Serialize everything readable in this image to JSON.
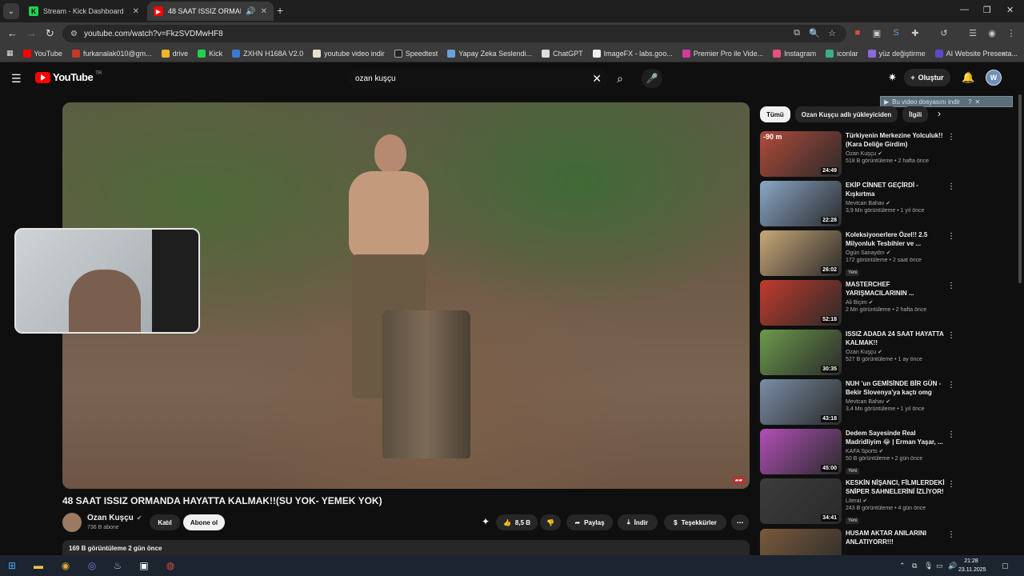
{
  "browser": {
    "tabs": [
      {
        "title": "Stream - Kick Dashboard",
        "favicon": "kick-icon",
        "active": false
      },
      {
        "title": "48 SAAT ISSIZ ORMANDA H",
        "favicon": "youtube-icon",
        "active": true
      }
    ],
    "url": "youtube.com/watch?v=FkzSVDMwHF8",
    "bookmarks": [
      "YouTube",
      "furkanalak010@gm...",
      "drive",
      "Kick",
      "ZXHN H168A V2.0",
      "youtube video indir",
      "Speedtest",
      "Yapay Zeka Seslendi...",
      "ChatGPT",
      "ImageFX - labs.goo...",
      "Premier Pro ile Vide...",
      "Instagram",
      "iconlar",
      "yüz değiştirme",
      "AI Website Presenta..."
    ]
  },
  "youtube": {
    "logo_text": "YouTube",
    "logo_country": "TR",
    "search_query": "ozan kuşçu",
    "create_label": "Oluştur",
    "avatar_letter": "W",
    "download_banner": "Bu video dosyasını indir",
    "download_banner_help": "?",
    "download_banner_close": "✕"
  },
  "video": {
    "title": "48 SAAT ISSIZ ORMANDA HAYATTA KALMAK!!(SU YOK- YEMEK YOK)",
    "channel": "Ozan Kuşçu",
    "subscribers": "736 B abone",
    "join_label": "Katıl",
    "subscribe_label": "Abone ol",
    "likes": "8,5 B",
    "share_label": "Paylaş",
    "download_label": "İndir",
    "thanks_label": "Teşekkürler",
    "views_date": "169 B görüntüleme  2 gün önce"
  },
  "chips": [
    "Tümü",
    "Ozan Kuşçu adlı yükleyiciden",
    "İlgili"
  ],
  "recommendations": [
    {
      "title": "Türkiyenin Merkezine Yolculuk!! (Kara Deliğe Girdim)",
      "channel": "Ozan Kuşçu",
      "meta": "518 B görüntüleme • 2 hafta önce",
      "duration": "24:49",
      "badge": "",
      "color": "#b04a3a"
    },
    {
      "title": "EKİP CİNNET GEÇİRDİ - Kışkırtma",
      "channel": "Mevtcan Bahav",
      "meta": "3,9 Mn görüntüleme • 1 yıl önce",
      "duration": "22:28",
      "badge": "",
      "color": "#8aa7c8"
    },
    {
      "title": "Koleksiyonerlere Özel!! 2.5 Milyonluk Tesbihler ve ...",
      "channel": "Ogün Sanaydın",
      "meta": "172 görüntüleme • 2 saat önce",
      "duration": "26:02",
      "badge": "Yeni",
      "color": "#c9a878"
    },
    {
      "title": "MASTERCHEF YARIŞMACILARININ ...",
      "channel": "Ali Biçim",
      "meta": "2 Mn görüntüleme • 2 hafta önce",
      "duration": "52:18",
      "badge": "",
      "color": "#c23a2c"
    },
    {
      "title": "ISSIZ ADADA 24 SAAT HAYATTA KALMAK!!",
      "channel": "Ozan Kuşçu",
      "meta": "527 B görüntüleme • 1 ay önce",
      "duration": "30:35",
      "badge": "",
      "color": "#6c9a4c"
    },
    {
      "title": "NUH 'un GEMİSİNDE BİR GÜN - Bekir Slovenya'ya kaçtı omg",
      "channel": "Mevtcan Bahav",
      "meta": "3,4 Mn görüntüleme • 1 yıl önce",
      "duration": "43:18",
      "badge": "",
      "color": "#7a8ea6"
    },
    {
      "title": "Dedem Sayesinde Real Madridliyim 😂 | Erman Yaşar, ...",
      "channel": "KAFA Sports",
      "meta": "50 B görüntüleme • 2 gün önce",
      "duration": "45:00",
      "badge": "Yeni",
      "color": "#b24fb8"
    },
    {
      "title": "KESKİN NİŞANCI, FİLMLERDEKİ SNİPER SAHNELERİNİ İZLİYOR!",
      "channel": "Literat",
      "meta": "243 B görüntüleme • 4 gün önce",
      "duration": "34:41",
      "badge": "Yeni",
      "color": "#3c3c3c"
    },
    {
      "title": "HUSAM AKTAR ANILARINI ANLATIYORR!!!",
      "channel": "",
      "meta": "",
      "duration": "",
      "badge": "",
      "color": "#7a5a3a"
    }
  ],
  "first_thumb_overlay": "-90 m",
  "taskbar": {
    "time": "21:28",
    "date": "23.11.2025"
  }
}
